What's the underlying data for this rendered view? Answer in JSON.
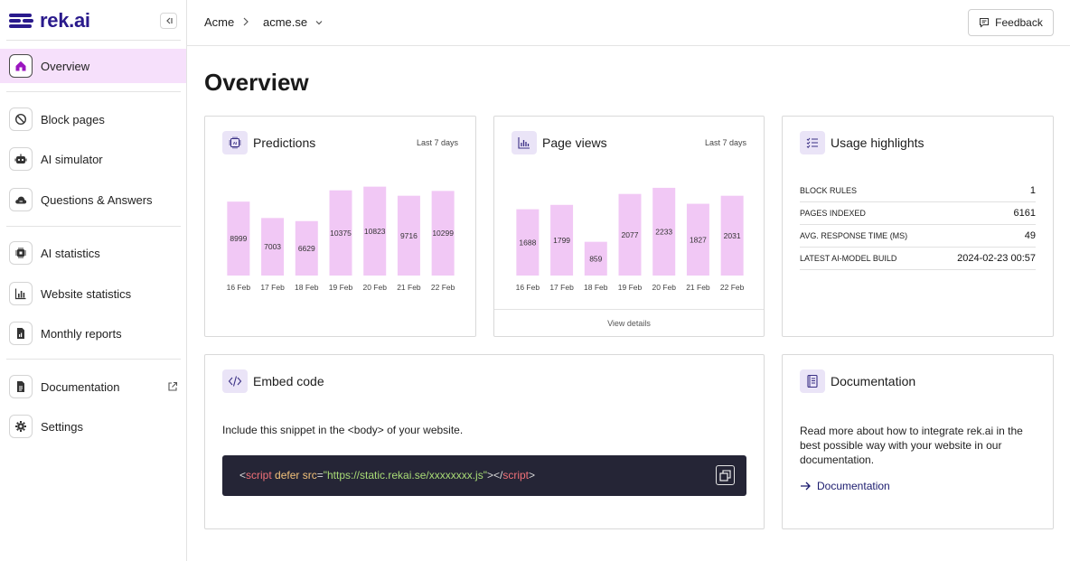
{
  "app": {
    "brand": "rek.ai"
  },
  "sidebar": {
    "items": [
      {
        "id": "overview",
        "label": "Overview",
        "icon": "home-icon",
        "active": true
      },
      {
        "id": "block-pages",
        "label": "Block pages",
        "icon": "block-icon"
      },
      {
        "id": "ai-simulator",
        "label": "AI simulator",
        "icon": "robot-icon"
      },
      {
        "id": "questions-answers",
        "label": "Questions & Answers",
        "icon": "cloud-chat-icon"
      },
      {
        "id": "ai-statistics",
        "label": "AI statistics",
        "icon": "chip-icon"
      },
      {
        "id": "website-statistics",
        "label": "Website statistics",
        "icon": "bar-chart-icon"
      },
      {
        "id": "monthly-reports",
        "label": "Monthly reports",
        "icon": "report-icon"
      },
      {
        "id": "documentation",
        "label": "Documentation",
        "icon": "document-icon",
        "external": true
      },
      {
        "id": "settings",
        "label": "Settings",
        "icon": "gear-icon"
      }
    ]
  },
  "header": {
    "breadcrumb_org": "Acme",
    "site": "acme.se",
    "feedback_label": "Feedback"
  },
  "main": {
    "title": "Overview",
    "predictions": {
      "title": "Predictions",
      "range": "Last 7 days",
      "chart_data": {
        "type": "bar",
        "categories": [
          "16 Feb",
          "17 Feb",
          "18 Feb",
          "19 Feb",
          "20 Feb",
          "21 Feb",
          "22 Feb"
        ],
        "values": [
          8999,
          7003,
          6629,
          10375,
          10823,
          9716,
          10299
        ],
        "title": "Predictions",
        "xlabel": "",
        "ylabel": "",
        "ylim": [
          0,
          11000
        ],
        "grid": false,
        "color": "#f1c8f5"
      }
    },
    "pageviews": {
      "title": "Page views",
      "range": "Last 7 days",
      "footer": "View details",
      "chart_data": {
        "type": "bar",
        "categories": [
          "16 Feb",
          "17 Feb",
          "18 Feb",
          "19 Feb",
          "20 Feb",
          "21 Feb",
          "22 Feb"
        ],
        "values": [
          1688,
          1799,
          859,
          2077,
          2233,
          1827,
          2031
        ],
        "title": "Page views",
        "xlabel": "",
        "ylabel": "",
        "ylim": [
          0,
          2300
        ],
        "grid": false,
        "color": "#f1c8f5"
      }
    },
    "usage": {
      "title": "Usage highlights",
      "rows": [
        {
          "label": "BLOCK RULES",
          "value": "1"
        },
        {
          "label": "PAGES INDEXED",
          "value": "6161"
        },
        {
          "label": "AVG. RESPONSE TIME (MS)",
          "value": "49"
        },
        {
          "label": "LATEST AI-MODEL BUILD",
          "value": "2024-02-23 00:57"
        }
      ]
    },
    "embed": {
      "title": "Embed code",
      "description": "Include this snippet in the <body> of your website.",
      "code": {
        "open_bracket": "<",
        "tag": "script",
        "attr1": " defer",
        "attr2": " src",
        "eq": "=",
        "value": "\"https://static.rekai.se/xxxxxxxx.js\"",
        "mid": "></",
        "close_tag": "script",
        "close_bracket": ">"
      }
    },
    "documentation": {
      "title": "Documentation",
      "description": "Read more about how to integrate rek.ai in the best possible way with your website in our documentation.",
      "link": "Documentation"
    }
  },
  "colors": {
    "accent": "#2a1a8c",
    "active_nav": "#f6e0fb",
    "bar": "#f1c8f5",
    "code_bg": "#252536",
    "code_tag": "#f07178",
    "code_attr": "#f3c27a",
    "code_string": "#a9dc76"
  }
}
